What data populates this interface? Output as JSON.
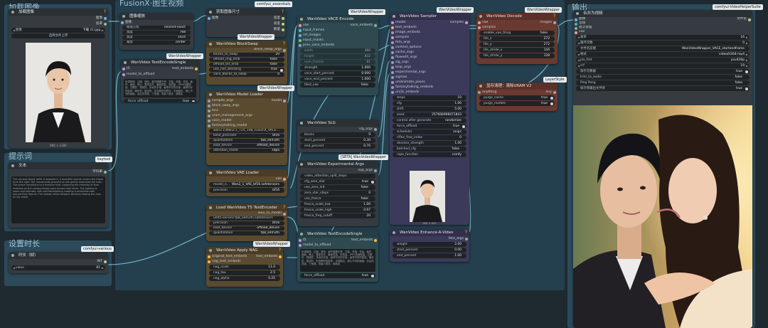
{
  "colors": {
    "canvas": "#1e2a30",
    "group_blue": "#2c4a5a",
    "node_body": "#353b40",
    "node_header": "#2b3035",
    "node_brown": "#5a4a30",
    "node_red": "#6a3a30",
    "node_purple": "#3c3a5a",
    "node_teal": "#2e4a50",
    "link": "#86c8d8"
  },
  "groups": {
    "load_image": "加载图像",
    "prompt": "提示词",
    "duration": "设置时长",
    "fusionx": "FusionX·图生视频",
    "output": "输出"
  },
  "badges": {
    "comfyui_essentials": "comfyui_essentials",
    "wanvideo_wrapper": "WanVideoWrapper",
    "set_vace": "[SETA] WanVideoWrapper",
    "kaytool": "kaytool",
    "comfyui_various": "comfyui-various",
    "layerstyle": "LayerStyle",
    "vhs": "comfyui-VideoHelperSuite"
  },
  "load_image_node": {
    "title": "加载图像",
    "image_file": "下载 (1).jpg",
    "upload_btn": "选择文件上传",
    "caption": "896 × 1280"
  },
  "resize_node": {
    "title": "图像缩放",
    "out_image": "图像",
    "out_width": "宽度",
    "out_height": "高度",
    "in_image": "图像",
    "interp_label": "插值方式",
    "interp": "nearest-exact",
    "width_label": "宽度",
    "width": "768",
    "height_label": "高度",
    "height": "1024",
    "crop_label": "裁剪",
    "crop": "center"
  },
  "getsize_node": {
    "title": "获取图像尺寸",
    "in_image": "图像",
    "out_w": "宽度",
    "out_h": "高度",
    "out_c": "数量"
  },
  "prompt_node": {
    "title": "文本",
    "out": "字符串",
    "text": "The camera slowly drifts in towards it. A beautiful woman enters the frame from the right. Her movements graceful as she gently embraces the man. The scene transitions to a medium shot, capturing the intensity of their embrace as the camera slowly pans across their faces. The lighting is warm and intimate, with soft backlighting creating a dreamlike halo around their figures. The woman leans forward, tenderly kissing the man on his cheek."
  },
  "duration_node": {
    "title": "时长（帧）",
    "out": "INT",
    "label": "value",
    "value": "81"
  },
  "textencode_single": {
    "title": "WanVideo TextEncodeSingle",
    "in_t5": "t5",
    "in_model": "model_to_offload",
    "out": "text_embeds",
    "text": "色调艳丽，过曝，静态，细节模糊不清，字幕，风格，作品，画作，画面，静止，整体发灰，最差质量，低质量，JPEG压缩残留，丑陋的，残缺的，多余的手指，画得不好的手部，画得不好的脸部，畸形的，毁容的，形态畸形的肢体，手指融合，静止不动的画面，杂乱的背景，三条腿，背景人很多，倒着走",
    "force_offload": "force_offload",
    "force_offload_v": "true"
  },
  "blockswap": {
    "title": "WanVideo BlockSwap",
    "out": "block_swap_args",
    "w": [
      [
        "blocks_to_swap",
        "20"
      ],
      [
        "offload_img_emb",
        "false"
      ],
      [
        "offload_txt_emb",
        "false"
      ],
      [
        "use_non_blocking",
        "true"
      ],
      [
        "vace_blocks_to_swap",
        "0"
      ]
    ]
  },
  "model_loader": {
    "title": "WanVideo Model Loader",
    "out": "model",
    "ins": [
      "compile_args",
      "block_swap_args",
      "lora",
      "vram_management_args",
      "vace_model",
      "fantasytalking_model"
    ],
    "w": [
      [
        "",
        "wan2.1\\Wan2.1_T2V_14B_FusionX_VACE-..."
      ],
      [
        "base_precision",
        "bf16"
      ],
      [
        "quantization",
        "fp8_e4m3fn"
      ],
      [
        "load_device",
        "offload_device"
      ],
      [
        "attention_mode",
        "sdpa"
      ]
    ]
  },
  "vae_loader": {
    "title": "WanVideo VAE Loader",
    "out": "vae",
    "w": [
      [
        "model_n...",
        "Wan2_1_VAE_bf16.safetensors"
      ],
      [
        "precision",
        "bf16"
      ]
    ]
  },
  "t5_loader": {
    "title": "Load WanVideo T5 TextEncoder",
    "out": "wan_t5_model",
    "w": [
      [
        "",
        "umt5-xxl-enc-fp8_e4m3fn.safetensors"
      ],
      [
        "precision",
        "bf16"
      ],
      [
        "load_device",
        "offload_device"
      ],
      [
        "quantization",
        "fp8_e4m3fn"
      ]
    ]
  },
  "nag": {
    "title": "WanVideo Apply NAG",
    "ins": [
      "original_text_embeds",
      "nag_text_embeds"
    ],
    "out": "text_embeds",
    "w": [
      [
        "nag_scale",
        "11.0"
      ],
      [
        "nag_tau",
        "2.5"
      ],
      [
        "nag_alpha",
        "0.25"
      ]
    ]
  },
  "vace_encode": {
    "title": "WanVideo VACE Encode",
    "ins": [
      "vae",
      "input_frames",
      "ref_images",
      "input_masks",
      "prev_vace_embeds"
    ],
    "out": "vace_embeds",
    "w": [
      [
        "width",
        "480"
      ],
      [
        "height",
        "832"
      ],
      [
        "num_frames",
        "81"
      ],
      [
        "strength",
        "1.000"
      ],
      [
        "vace_start_percent",
        "0.000"
      ],
      [
        "vace_end_percent",
        "1.000"
      ],
      [
        "tiled_vae",
        "false"
      ]
    ]
  },
  "slg": {
    "title": "WanVideo SLG",
    "out": "slg_args",
    "w": [
      [
        "blocks",
        "9"
      ],
      [
        "start_percent",
        "0.30"
      ],
      [
        "end_percent",
        "0.70"
      ]
    ]
  },
  "exp_args": {
    "title": "WanVideo Experimental Args",
    "out": "exp_args",
    "w": [
      [
        "video_attention_split_steps",
        ""
      ],
      [
        "cfg_zero_star",
        "true"
      ],
      [
        "use_zero_init",
        "false"
      ],
      [
        "zero_star_steps",
        "0"
      ],
      [
        "use_fresca",
        "false"
      ],
      [
        "fresca_scale_low",
        "1.00"
      ],
      [
        "fresca_scale_high",
        "0.97"
      ],
      [
        "fresca_freq_cutoff",
        "20"
      ]
    ]
  },
  "textencode_single2": {
    "title": "WanVideo TextEncodeSingle",
    "in_t5": "t5",
    "in_model": "model_to_offload",
    "out": "text_embeds",
    "text": "色调艳丽，过曝，静态，细节模糊不清，字幕，风格，作品，画作，画面，静止，整体发灰，最差质量，低质量，JPEG压缩残留，丑陋的，残缺的，多余的手指，画得不好的手部，画得不好的脸部，畸形的，毁容的，形态畸形的肢体，手指融合，静止不动的画面，杂乱的背景，三条腿，背景人很多，倒着走",
    "force_offload": "force_offload",
    "force_offload_v": "true"
  },
  "sampler": {
    "title": "WanVideo Sampler",
    "out": "samples",
    "ins": [
      "model",
      "text_embeds",
      "image_embeds",
      "samples",
      "feta_args",
      "context_options",
      "cache_args",
      "flowedit_args",
      "slg_args",
      "loop_args",
      "experimental_args",
      "sigmas",
      "unianimate_poses",
      "fantasytalking_embeds",
      "uni3c_embeds"
    ],
    "w": [
      [
        "steps",
        "10"
      ],
      [
        "cfg",
        "1.00"
      ],
      [
        "shift",
        "5.00"
      ],
      [
        "seed",
        "257666998471843"
      ],
      [
        "control after generate",
        "randomize"
      ],
      [
        "force_offload",
        "true"
      ],
      [
        "scheduler",
        "unipc"
      ],
      [
        "riflex_freq_index",
        "0"
      ],
      [
        "denoise_strength",
        "1.00"
      ],
      [
        "batched_cfg",
        "false"
      ],
      [
        "rope_function",
        "comfy"
      ]
    ]
  },
  "decode": {
    "title": "WanVideo Decode",
    "ins": [
      "vae",
      "samples"
    ],
    "out": "images",
    "w": [
      [
        "enable_vae_tiling",
        "false"
      ],
      [
        "tile_x",
        "272"
      ],
      [
        "tile_y",
        "272"
      ],
      [
        "tile_stride_x",
        "144"
      ],
      [
        "tile_stride_y",
        "128"
      ]
    ]
  },
  "vram": {
    "title": "显存清理：清除VRAM V2",
    "in": "anything",
    "out": "any",
    "w": [
      [
        "purge_cache",
        "true"
      ],
      [
        "purge_models",
        "true"
      ]
    ]
  },
  "enhance": {
    "title": "WanVideo Enhance-A-Video",
    "out": "feta_args",
    "w": [
      [
        "weight",
        "2.00"
      ],
      [
        "start_percent",
        "0.00"
      ],
      [
        "end_percent",
        "1.00"
      ]
    ]
  },
  "sampler_preview_caption": "480 × 832",
  "vhs": {
    "title": "合并为视频",
    "ins": [
      "图像",
      "音频",
      "批次管理",
      "vae"
    ],
    "out": "文件名",
    "w": [
      [
        "帧率",
        "16"
      ],
      [
        "循环次数",
        "0"
      ],
      [
        "文件名前缀",
        "WanVideoWrapper_VACE_startendframe"
      ],
      [
        "格式",
        "video/h264-mp4"
      ],
      [
        "pix_fmt",
        "yuv420p"
      ],
      [
        "crf",
        "19"
      ],
      [
        "保存元数据",
        "true"
      ],
      [
        "trim_to_audio",
        "false"
      ],
      [
        "Ping Pong",
        "false"
      ],
      [
        "保存到输出文件夹",
        "true"
      ]
    ]
  }
}
